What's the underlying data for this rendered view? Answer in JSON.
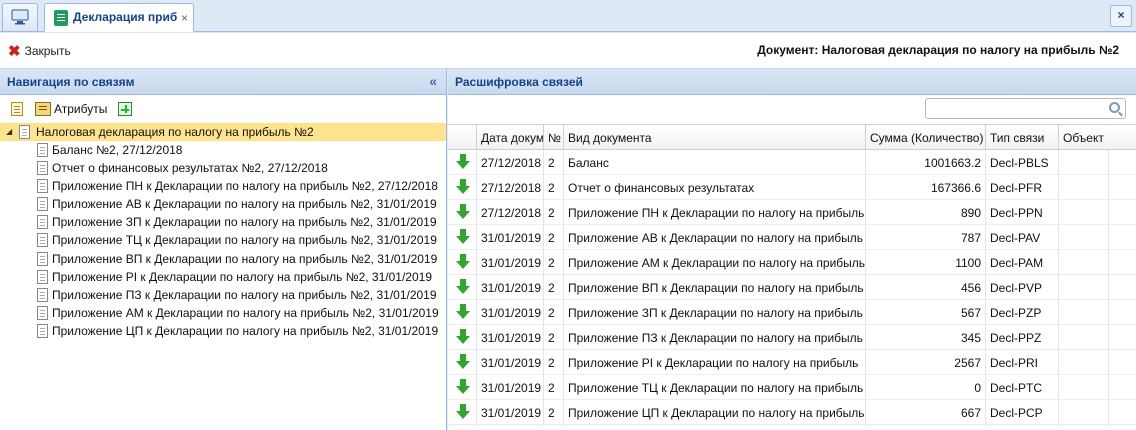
{
  "tabs": {
    "home_icon": "monitor-icon",
    "doc_tab_label": "Декларация приб",
    "doc_tab_close": "×",
    "window_close": "×"
  },
  "toolbar": {
    "close_label": "Закрыть",
    "document_title": "Документ: Налоговая декларация по налогу на прибыль №2"
  },
  "left": {
    "title": "Навигация по связям",
    "collapse": "«",
    "attributes_label": "Атрибуты",
    "root": "Налоговая декларация по налогу на прибыль №2",
    "items": [
      "Баланс №2, 27/12/2018",
      "Отчет о финансовых результатах №2, 27/12/2018",
      "Приложение ПН к Декларации по налогу на прибыль №2, 27/12/2018",
      "Приложение АВ к Декларации по налогу на прибыль №2, 31/01/2019",
      "Приложение ЗП к Декларации по налогу на прибыль №2, 31/01/2019",
      "Приложение ТЦ к Декларации по налогу на прибыль №2, 31/01/2019",
      "Приложение ВП к Декларации по налогу на прибыль №2, 31/01/2019",
      "Приложение PI к Декларации по налогу на прибыль №2, 31/01/2019",
      "Приложение ПЗ к Декларации по налогу на прибыль №2, 31/01/2019",
      "Приложение АМ к Декларации по налогу на прибыль №2, 31/01/2019",
      "Приложение ЦП к Декларации по налогу на прибыль №2, 31/01/2019"
    ]
  },
  "right": {
    "title": "Расшифровка связей",
    "search_placeholder": "",
    "columns": [
      "Дата докум",
      "№",
      "Вид документа",
      "Сумма (Количество)",
      "Тип связи",
      "Объект"
    ],
    "rows": [
      [
        "27/12/2018",
        "2",
        "Баланс",
        "1001663.2",
        "Decl-PBLS",
        ""
      ],
      [
        "27/12/2018",
        "2",
        "Отчет о финансовых результатах",
        "167366.6",
        "Decl-PFR",
        ""
      ],
      [
        "27/12/2018",
        "2",
        "Приложение ПН к Декларации по налогу на прибыль",
        "890",
        "Decl-PPN",
        ""
      ],
      [
        "31/01/2019",
        "2",
        "Приложение АВ к Декларации по налогу на прибыль",
        "787",
        "Decl-PAV",
        ""
      ],
      [
        "31/01/2019",
        "2",
        "Приложение АМ к Декларации по налогу на прибыль",
        "1100",
        "Decl-PAM",
        ""
      ],
      [
        "31/01/2019",
        "2",
        "Приложение ВП к Декларации по налогу на прибыль",
        "456",
        "Decl-PVP",
        ""
      ],
      [
        "31/01/2019",
        "2",
        "Приложение ЗП к Декларации по налогу на прибыль",
        "567",
        "Decl-PZP",
        ""
      ],
      [
        "31/01/2019",
        "2",
        "Приложение ПЗ к Декларации по налогу на прибыль",
        "345",
        "Decl-PPZ",
        ""
      ],
      [
        "31/01/2019",
        "2",
        "Приложение PI к Декларации по налогу на прибыль",
        "2567",
        "Decl-PRI",
        ""
      ],
      [
        "31/01/2019",
        "2",
        "Приложение ТЦ к Декларации по налогу на прибыль",
        "0",
        "Decl-PTC",
        ""
      ],
      [
        "31/01/2019",
        "2",
        "Приложение ЦП к Декларации по налогу на прибыль",
        "667",
        "Decl-PCP",
        ""
      ]
    ]
  }
}
